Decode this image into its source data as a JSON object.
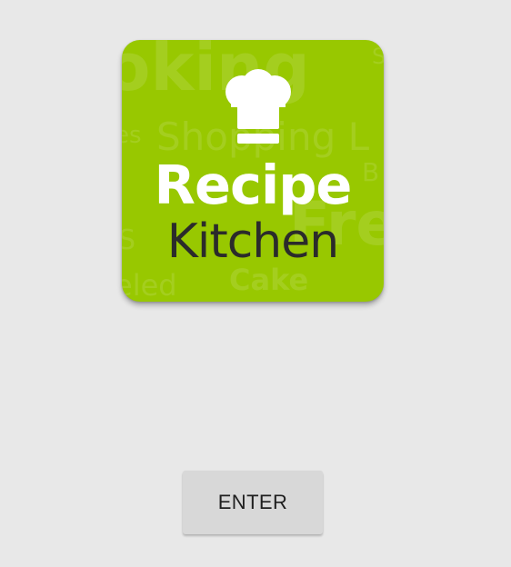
{
  "splash": {
    "logo": {
      "title_line1": "Recipe",
      "title_line2": "Kitchen",
      "icon": "chef-hat-icon",
      "background_words": [
        "oking",
        "S",
        "es",
        "Shopping L",
        "B",
        "Fre",
        "S",
        "eled",
        "Cake"
      ],
      "colors": {
        "background": "#98c800",
        "title_line1": "#ffffff",
        "title_line2": "#2b2b2b",
        "watermark": "rgba(255,255,255,0.12)"
      }
    },
    "enter_button": {
      "label": "ENTER"
    },
    "page_background": "#e8e8e8"
  }
}
